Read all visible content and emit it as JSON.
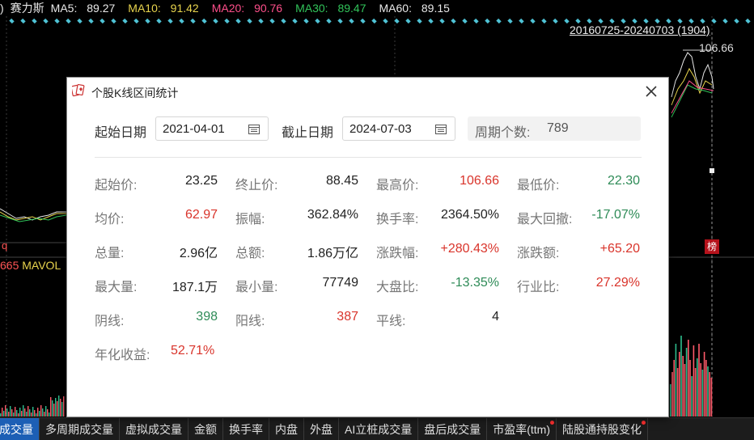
{
  "chart_header": {
    "fragment": ")",
    "stock_name": "赛力斯",
    "ma": [
      {
        "label": "MA5:",
        "value": "89.27"
      },
      {
        "label": "MA10:",
        "value": "91.42"
      },
      {
        "label": "MA20:",
        "value": "90.76"
      },
      {
        "label": "MA30:",
        "value": "89.47"
      },
      {
        "label": "MA60:",
        "value": "89.15"
      }
    ],
    "colors": {
      "ma5": "#e8e8e8",
      "ma10": "#e8d44d",
      "ma20": "#ff4f8b",
      "ma30": "#31c45a",
      "ma60": "#e8e8e8"
    }
  },
  "chart": {
    "range_label": "20160725-20240703 (1904)",
    "price_max_label": "106.66",
    "rank_tag": "榜",
    "volume_indicator_fragment": "q",
    "mavol_prefix": "665",
    "mavol_label": "MAVOL"
  },
  "bottom_tabs": [
    {
      "label": "成交量",
      "active": true,
      "dot": false
    },
    {
      "label": "多周期成交量",
      "active": false,
      "dot": false
    },
    {
      "label": "虚拟成交量",
      "active": false,
      "dot": false
    },
    {
      "label": "金额",
      "active": false,
      "dot": false
    },
    {
      "label": "换手率",
      "active": false,
      "dot": false
    },
    {
      "label": "内盘",
      "active": false,
      "dot": false
    },
    {
      "label": "外盘",
      "active": false,
      "dot": false
    },
    {
      "label": "AI立桩成交量",
      "active": false,
      "dot": false
    },
    {
      "label": "盘后成交量",
      "active": false,
      "dot": false
    },
    {
      "label": "市盈率(ttm)",
      "active": false,
      "dot": true
    },
    {
      "label": "陆股通持股变化",
      "active": false,
      "dot": true
    }
  ],
  "dialog": {
    "title": "个股K线区间统计",
    "start_date_label": "起始日期",
    "start_date": "2021-04-01",
    "end_date_label": "截止日期",
    "end_date": "2024-07-03",
    "period_label": "周期个数:",
    "period_value": "789",
    "stats": [
      {
        "label": "起始价:",
        "value": "23.25",
        "color": "black"
      },
      {
        "label": "终止价:",
        "value": "88.45",
        "color": "black"
      },
      {
        "label": "最高价:",
        "value": "106.66",
        "color": "red"
      },
      {
        "label": "最低价:",
        "value": "22.30",
        "color": "green"
      },
      {
        "label": "均价:",
        "value": "62.97",
        "color": "red"
      },
      {
        "label": "振幅:",
        "value": "362.84%",
        "color": "black"
      },
      {
        "label": "换手率:",
        "value": "2364.50%",
        "color": "black"
      },
      {
        "label": "最大回撤:",
        "value": "-17.07%",
        "color": "green"
      },
      {
        "label": "总量:",
        "value": "2.96亿",
        "color": "black"
      },
      {
        "label": "总额:",
        "value": "1.86万亿",
        "color": "black"
      },
      {
        "label": "涨跌幅:",
        "value": "+280.43%",
        "color": "red"
      },
      {
        "label": "涨跌额:",
        "value": "+65.20",
        "color": "red"
      },
      {
        "label": "最大量:",
        "value": "187.1万",
        "color": "black"
      },
      {
        "label": "最小量:",
        "value": "77749",
        "color": "black"
      },
      {
        "label": "大盘比:",
        "value": "-13.35%",
        "color": "green"
      },
      {
        "label": "行业比:",
        "value": "27.29%",
        "color": "red"
      },
      {
        "label": "阴线:",
        "value": "398",
        "color": "green"
      },
      {
        "label": "阳线:",
        "value": "387",
        "color": "red"
      },
      {
        "label": "平线:",
        "value": "4",
        "color": "black"
      },
      {
        "label": "",
        "value": "",
        "color": "black"
      },
      {
        "label": "年化收益:",
        "value": "52.71%",
        "color": "red"
      }
    ]
  }
}
